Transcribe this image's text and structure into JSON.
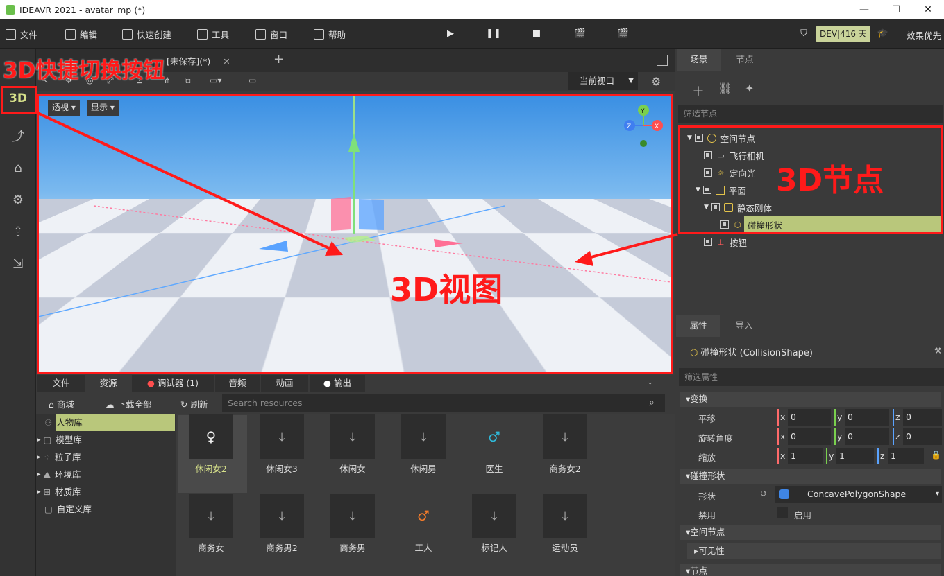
{
  "window": {
    "title": "IDEAVR 2021 - avatar_mp (*)",
    "min": "—",
    "max": "☐",
    "close": "✕"
  },
  "menu": [
    {
      "label": "文件"
    },
    {
      "label": "编辑"
    },
    {
      "label": "快速创建"
    },
    {
      "label": "工具"
    },
    {
      "label": "窗口"
    },
    {
      "label": "帮助"
    }
  ],
  "status": {
    "dev": "DEV|416 天",
    "quality": "效果优先"
  },
  "editor_tabs": {
    "scene_tab": "[未保存](*)",
    "add": "+"
  },
  "viewport": {
    "view_select": "当前视口",
    "perspective": "透视",
    "display": "显示",
    "gizmo": {
      "y": "Y",
      "x": "X",
      "z": "Z"
    }
  },
  "left_toolbar": {
    "mode_3d": "3D"
  },
  "annotations": {
    "switch_button": "3D快捷切换按钮",
    "node": "3D节点",
    "view": "3D视图"
  },
  "scene_panel": {
    "tabs": [
      "场景",
      "节点"
    ],
    "filter": "筛选节点",
    "tree": [
      {
        "label": "空间节点"
      },
      {
        "label": "飞行相机"
      },
      {
        "label": "定向光"
      },
      {
        "label": "平面"
      },
      {
        "label": "静态刚体"
      },
      {
        "label": "碰撞形状"
      },
      {
        "label": "按钮"
      }
    ]
  },
  "inspector": {
    "tabs": [
      "属性",
      "导入"
    ],
    "node_title": "碰撞形状 (CollisionShape)",
    "filter": "筛选属性",
    "transform_section": "变换",
    "translate_label": "平移",
    "rotate_label": "旋转角度",
    "scale_label": "缩放",
    "translate": [
      "0",
      "0",
      "0"
    ],
    "rotate": [
      "0",
      "0",
      "0"
    ],
    "scale": [
      "1",
      "1",
      "1"
    ],
    "axes": [
      "x",
      "y",
      "z"
    ],
    "collision_section": "碰撞形状",
    "shape_label": "形状",
    "shape_value": "ConcavePolygonShape",
    "disabled_label": "禁用",
    "enable_label": "启用",
    "spatial_section": "空间节点",
    "visibility": "可见性",
    "node_section": "节点"
  },
  "bottom_panel": {
    "tabs": [
      "文件",
      "资源",
      "调试器 (1)",
      "音频",
      "动画",
      "输出"
    ],
    "store": "商城",
    "download_all": "下载全部",
    "refresh": "刷新",
    "search_placeholder": "Search resources",
    "libraries": [
      "人物库",
      "模型库",
      "粒子库",
      "环境库",
      "材质库",
      "自定义库"
    ],
    "assets": [
      "休闲女2",
      "休闲女3",
      "休闲女",
      "休闲男",
      "医生",
      "商务女2",
      "商务女",
      "商务男2",
      "商务男",
      "工人",
      "标记人",
      "运动员"
    ]
  }
}
